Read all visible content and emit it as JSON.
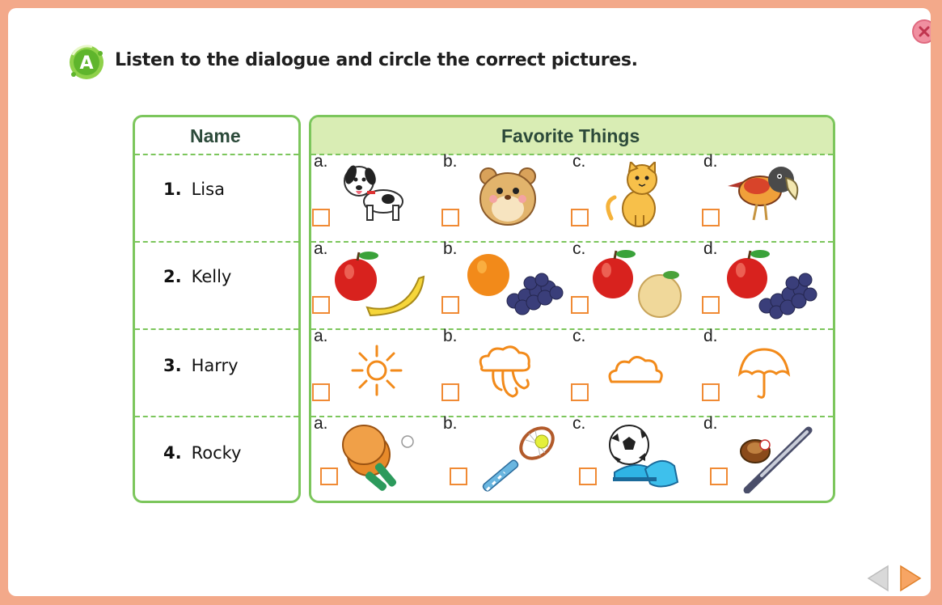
{
  "section": {
    "badge_letter": "A"
  },
  "instruction": "Listen to the dialogue and circle the correct pictures.",
  "table": {
    "name_header": "Name",
    "things_header": "Favorite Things",
    "rows": [
      {
        "number": "1.",
        "name": "Lisa",
        "options": [
          {
            "letter": "a.",
            "icon": "dog-icon"
          },
          {
            "letter": "b.",
            "icon": "hamster-icon"
          },
          {
            "letter": "c.",
            "icon": "cat-icon"
          },
          {
            "letter": "d.",
            "icon": "parrot-icon"
          }
        ]
      },
      {
        "number": "2.",
        "name": "Kelly",
        "options": [
          {
            "letter": "a.",
            "icon": "apple-banana-icon"
          },
          {
            "letter": "b.",
            "icon": "orange-grapes-icon"
          },
          {
            "letter": "c.",
            "icon": "apple-pear-icon"
          },
          {
            "letter": "d.",
            "icon": "apple-grapes-icon"
          }
        ]
      },
      {
        "number": "3.",
        "name": "Harry",
        "options": [
          {
            "letter": "a.",
            "icon": "sun-icon"
          },
          {
            "letter": "b.",
            "icon": "wind-icon"
          },
          {
            "letter": "c.",
            "icon": "cloud-icon"
          },
          {
            "letter": "d.",
            "icon": "umbrella-icon"
          }
        ]
      },
      {
        "number": "4.",
        "name": "Rocky",
        "options": [
          {
            "letter": "a.",
            "icon": "ping-pong-icon"
          },
          {
            "letter": "b.",
            "icon": "tennis-icon"
          },
          {
            "letter": "c.",
            "icon": "soccer-icon"
          },
          {
            "letter": "d.",
            "icon": "baseball-icon"
          }
        ]
      }
    ]
  },
  "colors": {
    "border": "#7cc65c",
    "header_fill": "#d9edb4",
    "checkbox": "#f08a34",
    "frame": "#f3a98a",
    "close": "#f08fa0"
  }
}
